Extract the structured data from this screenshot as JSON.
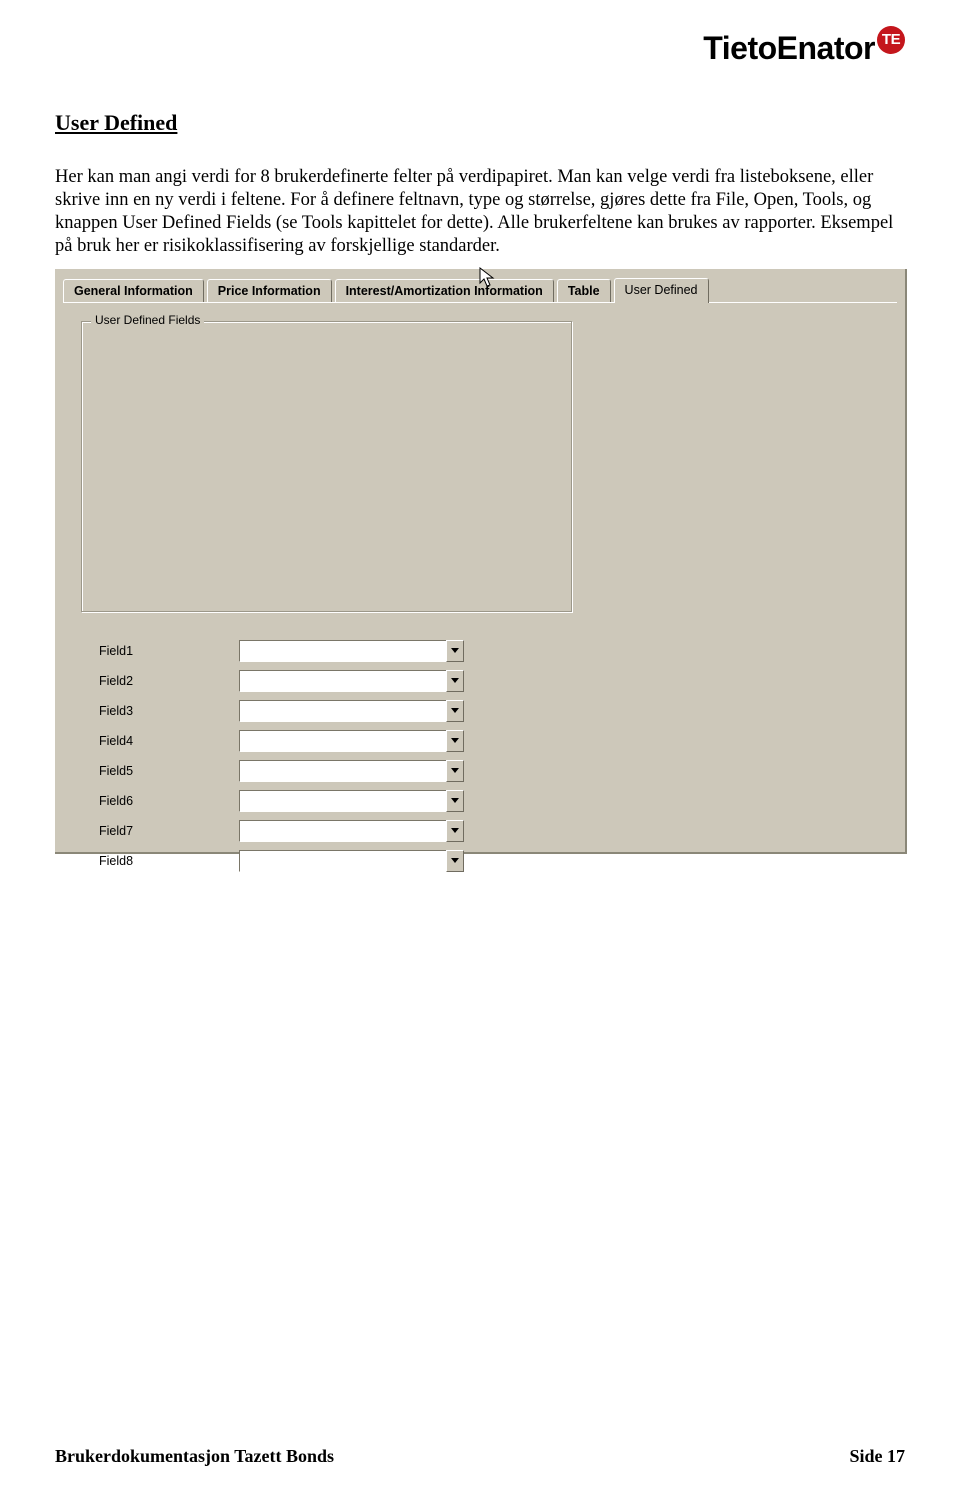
{
  "logo": {
    "brand": "TietoEnator",
    "badge": "TE"
  },
  "heading": "User Defined",
  "paragraph": "Her kan man angi verdi for 8 brukerdefinerte felter på verdipapiret. Man kan velge verdi fra listeboksene, eller skrive inn en ny verdi i feltene. For å definere feltnavn, type og størrelse, gjøres dette fra File, Open, Tools, og knappen User Defined Fields (se Tools kapittelet for dette). Alle brukerfeltene kan brukes av rapporter. Eksempel på bruk her er risikoklassifisering av forskjellige standarder.",
  "tabs": {
    "general": "General Information",
    "price": "Price Information",
    "interest": "Interest/Amortization Information",
    "table": "Table",
    "userdef": "User Defined"
  },
  "groupbox_title": "User Defined Fields",
  "fields": [
    {
      "label": "Field1",
      "value": ""
    },
    {
      "label": "Field2",
      "value": ""
    },
    {
      "label": "Field3",
      "value": ""
    },
    {
      "label": "Field4",
      "value": ""
    },
    {
      "label": "Field5",
      "value": ""
    },
    {
      "label": "Field6",
      "value": ""
    },
    {
      "label": "Field7",
      "value": ""
    },
    {
      "label": "Field8",
      "value": ""
    }
  ],
  "footer": {
    "left": "Brukerdokumentasjon Tazett Bonds",
    "right": "Side 17"
  }
}
